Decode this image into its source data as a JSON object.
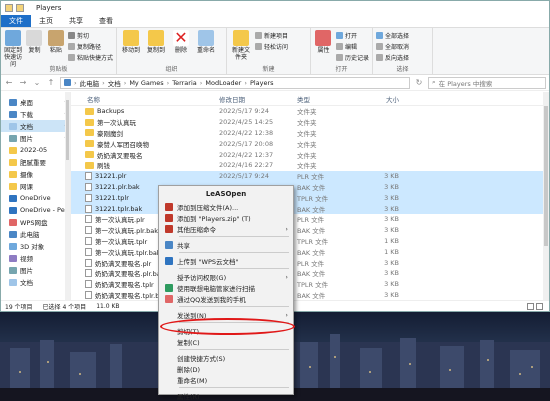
{
  "window": {
    "title": "Players"
  },
  "tabs": [
    "文件",
    "主页",
    "共享",
    "查看"
  ],
  "ribbon": {
    "clipboard": {
      "label": "剪贴板",
      "pin": "固定到快速访问",
      "copy": "复制",
      "paste": "粘贴",
      "cut": "剪切",
      "copy_path": "复制路径",
      "paste_shortcut": "粘贴快捷方式"
    },
    "organize": {
      "label": "组织",
      "move_to": "移动到",
      "copy_to": "复制到",
      "delete": "删除",
      "rename": "重命名"
    },
    "new": {
      "label": "新建",
      "new_folder": "新建文件夹",
      "new_item": "新建项目",
      "easy_access": "轻松访问"
    },
    "open": {
      "label": "打开",
      "properties": "属性",
      "open": "打开",
      "edit": "编辑",
      "history": "历史记录"
    },
    "select": {
      "label": "选择",
      "select_all": "全部选择",
      "select_none": "全部取消",
      "invert": "反向选择"
    }
  },
  "address": {
    "crumbs": [
      "此电脑",
      "文档",
      "My Games",
      "Terraria",
      "ModLoader",
      "Players"
    ],
    "search_placeholder": "在 Players 中搜索"
  },
  "nav": {
    "items": [
      {
        "label": "桌面",
        "pinned": true
      },
      {
        "label": "下载",
        "pinned": true
      },
      {
        "label": "文档",
        "pinned": true,
        "selected": true
      },
      {
        "label": "图片",
        "pinned": true
      },
      {
        "label": "2022-05",
        "pinned": false
      },
      {
        "label": "肥腻重要",
        "pinned": false
      },
      {
        "label": "摄像",
        "pinned": false
      },
      {
        "label": "网课",
        "pinned": false
      },
      {
        "label": "OneDrive",
        "pinned": false
      },
      {
        "label": "OneDrive - Pers",
        "pinned": false
      },
      {
        "label": "WPS网盘",
        "pinned": false
      },
      {
        "label": "此电脑",
        "pinned": false
      },
      {
        "label": "3D 对象",
        "pinned": false
      },
      {
        "label": "视频",
        "pinned": false
      },
      {
        "label": "图片",
        "pinned": false
      },
      {
        "label": "文档",
        "pinned": false
      }
    ]
  },
  "columns": {
    "name": "名称",
    "date": "修改日期",
    "type": "类型",
    "size": "大小"
  },
  "files": [
    {
      "name": "Backups",
      "date": "2022/5/17 9:24",
      "type": "文件夹",
      "size": "",
      "kind": "folder"
    },
    {
      "name": "第一次认真玩",
      "date": "2022/4/25 14:25",
      "type": "文件夹",
      "size": "",
      "kind": "folder"
    },
    {
      "name": "豪刚魔剑",
      "date": "2022/4/22 12:38",
      "type": "文件夹",
      "size": "",
      "kind": "folder"
    },
    {
      "name": "豪赞人军团召唤物",
      "date": "2022/5/17 20:08",
      "type": "文件夹",
      "size": "",
      "kind": "folder"
    },
    {
      "name": "奶奶满叉要吸名",
      "date": "2022/4/22 12:37",
      "type": "文件夹",
      "size": "",
      "kind": "folder"
    },
    {
      "name": "刷钱",
      "date": "2022/4/16 22:27",
      "type": "文件夹",
      "size": "",
      "kind": "folder"
    },
    {
      "name": "31221.plr",
      "date": "2022/5/17 9:24",
      "type": "PLR 文件",
      "size": "3 KB",
      "kind": "file",
      "selected": true
    },
    {
      "name": "31221.plr.bak",
      "date": "",
      "type": "BAK 文件",
      "size": "3 KB",
      "kind": "file",
      "selected": true
    },
    {
      "name": "31221.tplr",
      "date": "",
      "type": "TPLR 文件",
      "size": "3 KB",
      "kind": "file",
      "selected": true
    },
    {
      "name": "31221.tplr.bak",
      "date": "",
      "type": "BAK 文件",
      "size": "3 KB",
      "kind": "file",
      "selected": true
    },
    {
      "name": "第一次认真玩.plr",
      "date": "",
      "type": "PLR 文件",
      "size": "3 KB",
      "kind": "file"
    },
    {
      "name": "第一次认真玩.plr.bak",
      "date": "",
      "type": "BAK 文件",
      "size": "3 KB",
      "kind": "file"
    },
    {
      "name": "第一次认真玩.tplr",
      "date": "",
      "type": "TPLR 文件",
      "size": "1 KB",
      "kind": "file"
    },
    {
      "name": "第一次认真玩.tplr.bak",
      "date": "",
      "type": "BAK 文件",
      "size": "1 KB",
      "kind": "file"
    },
    {
      "name": "奶奶满叉要吸名.plr",
      "date": "",
      "type": "PLR 文件",
      "size": "3 KB",
      "kind": "file"
    },
    {
      "name": "奶奶满叉要吸名.plr.bak",
      "date": "",
      "type": "BAK 文件",
      "size": "3 KB",
      "kind": "file"
    },
    {
      "name": "奶奶满叉要吸名.tplr",
      "date": "",
      "type": "TPLR 文件",
      "size": "3 KB",
      "kind": "file"
    },
    {
      "name": "奶奶满叉要吸名.tplr.bak",
      "date": "",
      "type": "BAK 文件",
      "size": "3 KB",
      "kind": "file"
    }
  ],
  "status": {
    "count": "19 个项目",
    "selection": "已选择 4 个项目",
    "size": "11.0 KB"
  },
  "context_menu": {
    "header": "LeASOpen",
    "items": [
      {
        "label": "添加到压缩文件(A)...",
        "icon": "archive-icon",
        "group": 1
      },
      {
        "label": "添加到 \"Players.zip\" (T)",
        "icon": "archive-icon",
        "group": 1
      },
      {
        "label": "其他压缩命令",
        "icon": "archive-icon",
        "group": 1,
        "submenu": true
      },
      {
        "label": "共享",
        "icon": "share-icon",
        "group": 2
      },
      {
        "label": "上传到 \"WPS云文档\"",
        "icon": "cloud-upload-icon",
        "group": 3
      },
      {
        "label": "授予访问权限(G)",
        "icon": "",
        "group": 4,
        "submenu": true
      },
      {
        "label": "使用联想电脑管家进行扫描",
        "icon": "shield-icon",
        "group": 4
      },
      {
        "label": "通过QQ发送到我的手机",
        "icon": "qq-icon",
        "group": 4
      },
      {
        "label": "发送到(N)",
        "icon": "",
        "group": 5,
        "submenu": true
      },
      {
        "label": "剪切(T)",
        "icon": "",
        "group": 6
      },
      {
        "label": "复制(C)",
        "icon": "",
        "group": 6
      },
      {
        "label": "创建快捷方式(S)",
        "icon": "",
        "group": 7
      },
      {
        "label": "删除(D)",
        "icon": "",
        "group": 7
      },
      {
        "label": "重命名(M)",
        "icon": "",
        "group": 7
      },
      {
        "label": "属性(R)",
        "icon": "",
        "group": 8
      }
    ]
  },
  "colors": {
    "accent": "#1e6fc8",
    "selection": "#cce8ff",
    "highlight_ring": "#e01818"
  }
}
